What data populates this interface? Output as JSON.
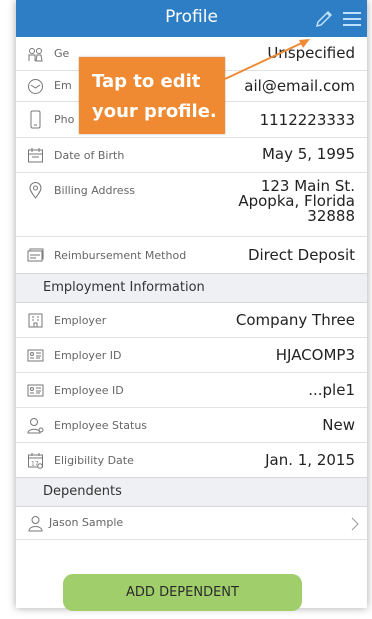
{
  "header": {
    "title": "Profile",
    "edit_icon": "pencil-icon",
    "menu_icon": "hamburger-menu-icon",
    "color": "#2e7ec5"
  },
  "callout": {
    "line1": "Tap to edit",
    "line2": "your profile.",
    "color": "#ef8a33"
  },
  "profile_rows": [
    {
      "label": "Ge",
      "value": "Unspecified",
      "icon": "gender-icon"
    },
    {
      "label": "Em",
      "value": "ail@email.com",
      "icon": "email-icon"
    },
    {
      "label": "Pho",
      "value": "1112223333",
      "icon": "phone-icon"
    },
    {
      "label": "Date of Birth",
      "value": "May 5, 1995",
      "icon": "calendar-icon"
    },
    {
      "label": "Billing Address",
      "value_lines": [
        "123 Main St.",
        "Apopka, Florida",
        "32888"
      ],
      "icon": "location-pin-icon"
    },
    {
      "label": "Reimbursement Method",
      "value": "Direct Deposit",
      "icon": "deposit-icon"
    }
  ],
  "employment": {
    "title": "Employment Information",
    "rows": [
      {
        "label": "Employer",
        "value": "Company Three",
        "icon": "building-icon"
      },
      {
        "label": "Employer ID",
        "value": "HJACOMP3",
        "icon": "id-card-icon"
      },
      {
        "label": "Employee ID",
        "value": "...ple1",
        "icon": "id-card-icon"
      },
      {
        "label": "Employee Status",
        "value": "New",
        "icon": "person-status-icon"
      },
      {
        "label": "Eligibility Date",
        "value": "Jan. 1, 2015",
        "icon": "calendar-check-icon"
      }
    ]
  },
  "dependents": {
    "title": "Dependents",
    "items": [
      {
        "name": "Jason Sample",
        "icon": "person-icon"
      }
    ],
    "add_button": "ADD DEPENDENT",
    "button_color": "#9fce6a"
  }
}
